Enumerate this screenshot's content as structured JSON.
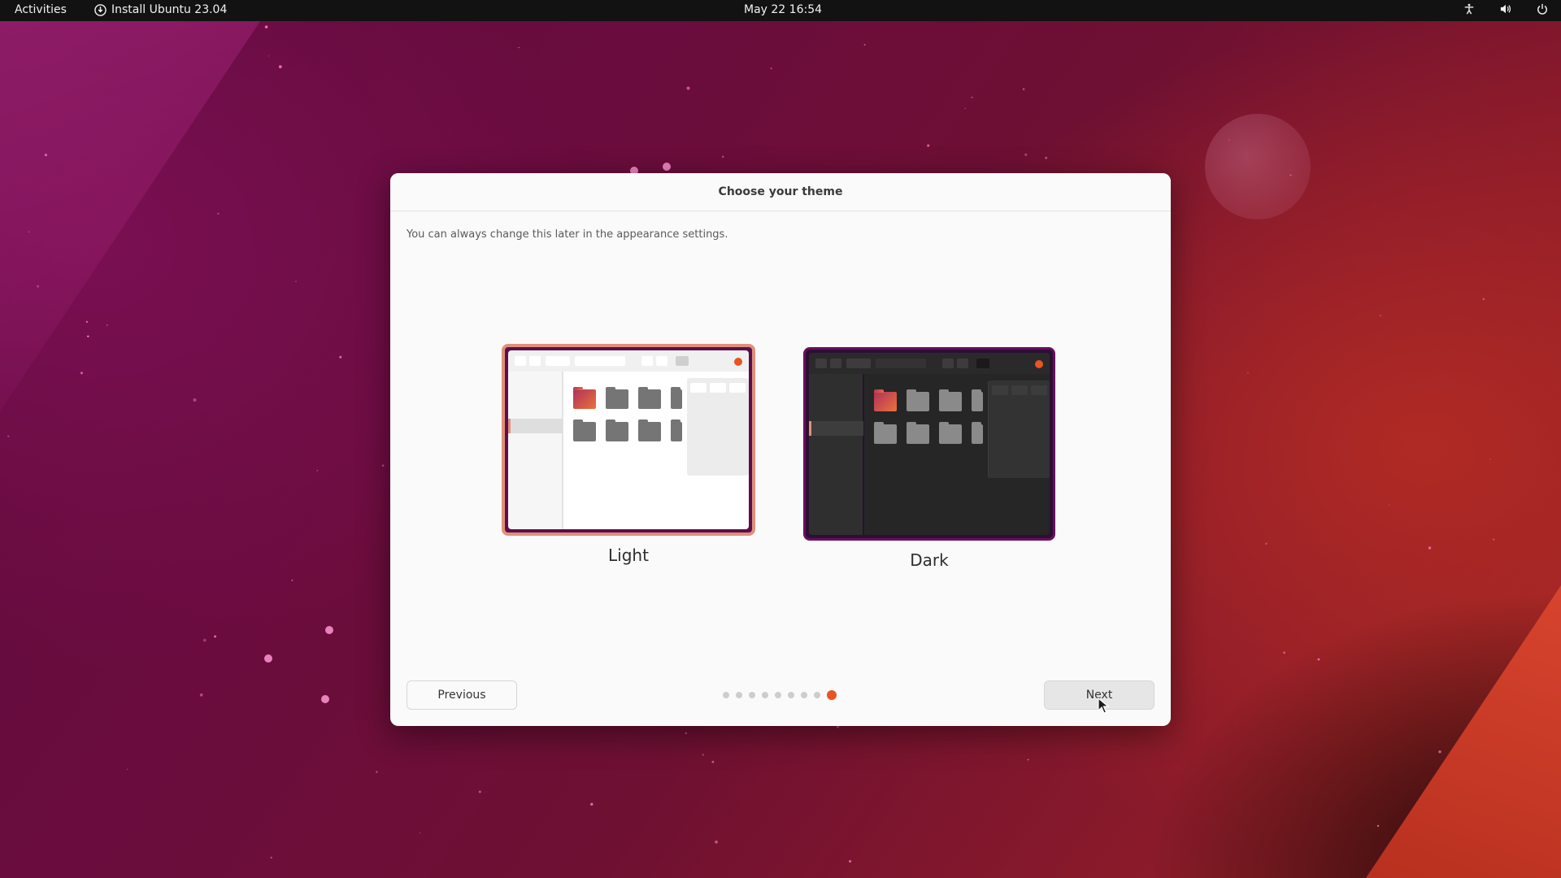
{
  "topbar": {
    "activities": "Activities",
    "app_title": "Install Ubuntu 23.04",
    "clock": "May 22  16:54",
    "tray_icons": [
      "accessibility-icon",
      "volume-icon",
      "power-icon"
    ]
  },
  "dialog": {
    "title": "Choose your theme",
    "subtitle": "You can always change this later in the appearance settings.",
    "themes": [
      {
        "label": "Light",
        "selected": true
      },
      {
        "label": "Dark",
        "selected": false
      }
    ],
    "previous_label": "Previous",
    "next_label": "Next",
    "pager": {
      "total": 9,
      "current": 9
    }
  },
  "colors": {
    "accent": "#e95420",
    "selection_border": "#e0907a",
    "topbar_bg": "#121212",
    "dialog_bg": "#fafafa"
  }
}
